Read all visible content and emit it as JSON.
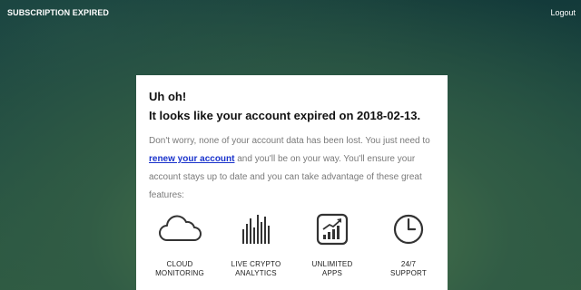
{
  "header": {
    "title": "SUBSCRIPTION EXPIRED",
    "logout_label": "Logout"
  },
  "card": {
    "heading": "Uh oh!",
    "subheading": "It looks like your account expired on 2018-02-13.",
    "body_before_link": "Don't worry, none of your account data has been lost. You just need to ",
    "link_text": "renew your account",
    "body_after_link": " and you'll be on your way. You'll ensure your account stays up to date and you can take advantage of these great features:"
  },
  "features": [
    {
      "icon": "cloud-icon",
      "line1": "CLOUD",
      "line2": "MONITORING"
    },
    {
      "icon": "bars-icon",
      "line1": "LIVE CRYPTO",
      "line2": "ANALYTICS"
    },
    {
      "icon": "chart-growth-icon",
      "line1": "UNLIMITED",
      "line2": "APPS"
    },
    {
      "icon": "clock-icon",
      "line1": "24/7",
      "line2": "SUPPORT"
    }
  ],
  "colors": {
    "link": "#1a33cc",
    "text_muted": "#7a7a7a",
    "background_dark": "#133a3a",
    "background_light": "#4f7a4c"
  }
}
